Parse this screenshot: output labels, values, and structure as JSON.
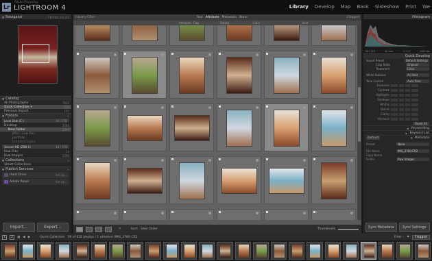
{
  "app": {
    "catalog": "Adobe Photoshop",
    "name": "LIGHTROOM 4",
    "logo": "Lr"
  },
  "modules": [
    "Library",
    "Develop",
    "Map",
    "Book",
    "Slideshow",
    "Print",
    "We"
  ],
  "active_module": "Library",
  "left": {
    "navigator": {
      "title": "Navigator",
      "opts": "FIT FILL 1:1 3:1"
    },
    "catalog": {
      "title": "Catalog",
      "items": [
        {
          "label": "All Photographs",
          "count": "7620"
        },
        {
          "label": "Quick Collection +",
          "count": "618"
        },
        {
          "label": "Previous Import",
          "count": "121"
        }
      ]
    },
    "folders": {
      "title": "Folders",
      "volumes": [
        {
          "label": "Local Disk (C:)",
          "count": "94 / 1TB"
        },
        {
          "label": "Second HD (ZRB-1)",
          "count": "14 / 1TB"
        }
      ],
      "items": [
        {
          "label": "Desktop",
          "count": "2284"
        },
        {
          "label": "New Folder",
          "count": "2284"
        },
        {
          "label": "JPGs - Low Res",
          "count": ""
        },
        {
          "label": "portfolio",
          "count": ""
        },
        {
          "label": "Untitled Export",
          "count": ""
        },
        {
          "label": "Raw Files",
          "count": "14"
        },
        {
          "label": "Raw Images",
          "count": "1290"
        }
      ]
    },
    "collections": {
      "title": "Collections",
      "items": [
        {
          "label": "Smart Collections",
          "count": ""
        }
      ]
    },
    "publish": {
      "title": "Publish Services",
      "items": [
        {
          "label": "Hard Drive",
          "count": "Set Up..."
        },
        {
          "label": "Adobe Revel",
          "count": "Set Up..."
        }
      ]
    },
    "import_label": "Import...",
    "export_label": "Export..."
  },
  "center": {
    "filter": {
      "label": "Library Filter :",
      "tabs": [
        "Text",
        "Attribute",
        "Metadata",
        "None"
      ],
      "active": "Attribute",
      "preset": "Flagged"
    },
    "attr": [
      "Attribute",
      "Flag",
      "Rating",
      "Color",
      "Kind"
    ],
    "toolbar": {
      "sort_label": "Sort:",
      "sort_value": "User Order",
      "thumbs_label": "Thumbnails"
    }
  },
  "right": {
    "histogram": {
      "title": "Histogram",
      "meta": [
        "ISO 125",
        "50 mm",
        "f / 3.2",
        "1/60 sec"
      ]
    },
    "quick": {
      "title": "Quick Develop",
      "preset_label": "Saved Preset",
      "preset_value": "Default Settings",
      "crop_label": "Crop Ratio",
      "crop_value": "Original",
      "treat_label": "Treatment",
      "treat_value": "Color",
      "wb_label": "White Balance",
      "wb_value": "As Shot",
      "tone_label": "Tone Control",
      "tone_value": "Auto Tone",
      "controls": [
        "Exposure",
        "Contrast",
        "Highlights",
        "Shadows",
        "Whites",
        "Blacks",
        "Clarity",
        "Vibrance"
      ],
      "reset": "Reset All"
    },
    "keywording": "Keywording",
    "keywordlist": "Keyword List",
    "metadata": {
      "title": "Metadata",
      "preset_sel": "Default",
      "rows": [
        {
          "label": "Preset",
          "value": "None"
        },
        {
          "label": "File Name",
          "value": "IMG_2780.CR2"
        },
        {
          "label": "Copy Name",
          "value": ""
        },
        {
          "label": "Folder",
          "value": "Raw Images"
        }
      ]
    },
    "sync_meta": "Sync Metadata",
    "sync_settings": "Sync Settings"
  },
  "bottom": {
    "pages": [
      "1",
      "2"
    ],
    "source": "Quick Collection",
    "count": "59 of 618 photos / 1 selected /IMG_2780.CR2",
    "filter_label": "Filter :",
    "filter_value": "Flagged"
  }
}
